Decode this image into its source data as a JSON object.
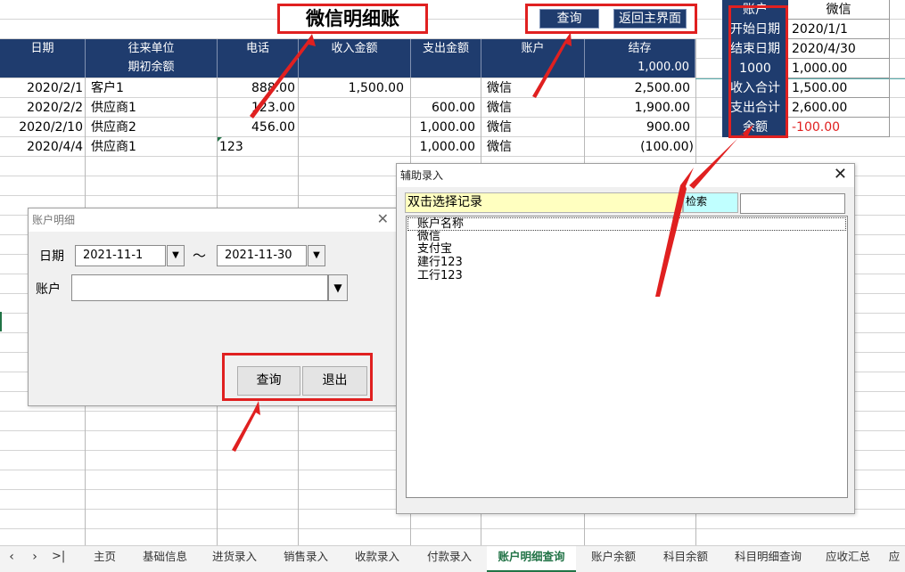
{
  "sheet": {
    "title": "微信明细账",
    "buttons": {
      "query": "查询",
      "back": "返回主界面"
    },
    "columns": [
      "日期",
      "往来单位",
      "电话",
      "收入金额",
      "支出金额",
      "账户",
      "结存"
    ],
    "opening_label": "期初余额",
    "opening_balance": "1,000.00",
    "rows": [
      {
        "date": "2020/2/1",
        "party": "客户1",
        "phone": "888.00",
        "income": "1,500.00",
        "expense": "",
        "account": "微信",
        "balance": "2,500.00"
      },
      {
        "date": "2020/2/2",
        "party": "供应商1",
        "phone": "123.00",
        "income": "",
        "expense": "600.00",
        "account": "微信",
        "balance": "1,900.00"
      },
      {
        "date": "2020/2/10",
        "party": "供应商2",
        "phone": "456.00",
        "income": "",
        "expense": "1,000.00",
        "account": "微信",
        "balance": "900.00"
      },
      {
        "date": "2020/4/4",
        "party": "供应商1",
        "phone": "123",
        "income": "",
        "expense": "1,000.00",
        "account": "微信",
        "balance": "(100.00)"
      }
    ]
  },
  "summary": {
    "rows": [
      {
        "label": "账户",
        "value": "微信"
      },
      {
        "label": "开始日期",
        "value": "2020/1/1"
      },
      {
        "label": "结束日期",
        "value": "2020/4/30"
      },
      {
        "label": "1000",
        "value": "1,000.00"
      },
      {
        "label": "收入合计",
        "value": "1,500.00"
      },
      {
        "label": "支出合计",
        "value": "2,600.00"
      },
      {
        "label": "余额",
        "value": "-100.00"
      }
    ],
    "negative_color": "#e02020"
  },
  "account_dialog": {
    "title": "账户明细",
    "date_label": "日期",
    "date_from": "2021-11-1",
    "tilde": "～",
    "date_to": "2021-11-30",
    "account_label": "账户",
    "account_value": "",
    "query_button": "查询",
    "exit_button": "退出"
  },
  "assist_dialog": {
    "title": "辅助录入",
    "hint": "双击选择记录",
    "search_label": "检索",
    "search_value": "",
    "list_header": "账户名称",
    "items": [
      "微信",
      "支付宝",
      "建行123",
      "工行123"
    ]
  },
  "tabs": {
    "items": [
      "主页",
      "基础信息",
      "进货录入",
      "销售录入",
      "收款录入",
      "付款录入",
      "账户明细查询",
      "账户余额",
      "科目余额",
      "科目明细查询",
      "应收汇总",
      "应"
    ],
    "active": "账户明细查询"
  },
  "colors": {
    "header_bg": "#1f3c6e",
    "annotation": "#e02020",
    "active_tab": "#217346"
  }
}
